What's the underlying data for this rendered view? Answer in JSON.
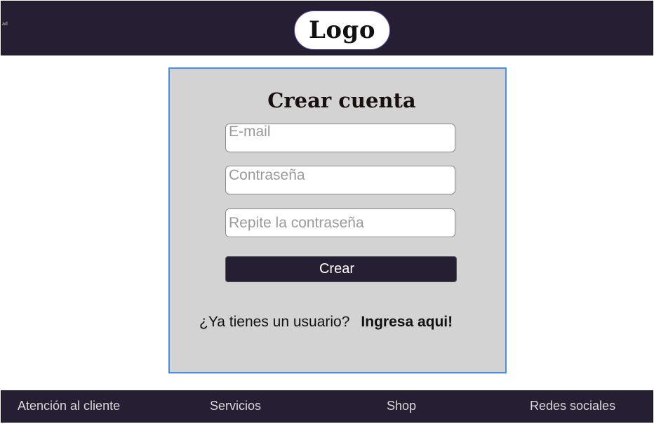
{
  "header": {
    "logo_text": "Logo",
    "corner_mark": "ad"
  },
  "signup_form": {
    "title": "Crear cuenta",
    "email_placeholder": "E-mail",
    "password_placeholder": "Contraseña",
    "repeat_password_placeholder": "Repite la contraseña",
    "submit_label": "Crear",
    "have_account_text": "¿Ya tienes un usuario?",
    "login_link_label": "Ingresa aqui!"
  },
  "footer": {
    "links": [
      "Atención al cliente",
      "Servicios",
      "Shop",
      "Redes sociales"
    ]
  },
  "colors": {
    "nav_background": "#261f33",
    "card_background": "#d3d3d3",
    "card_border": "#4a90e2",
    "button_background": "#261f33"
  }
}
